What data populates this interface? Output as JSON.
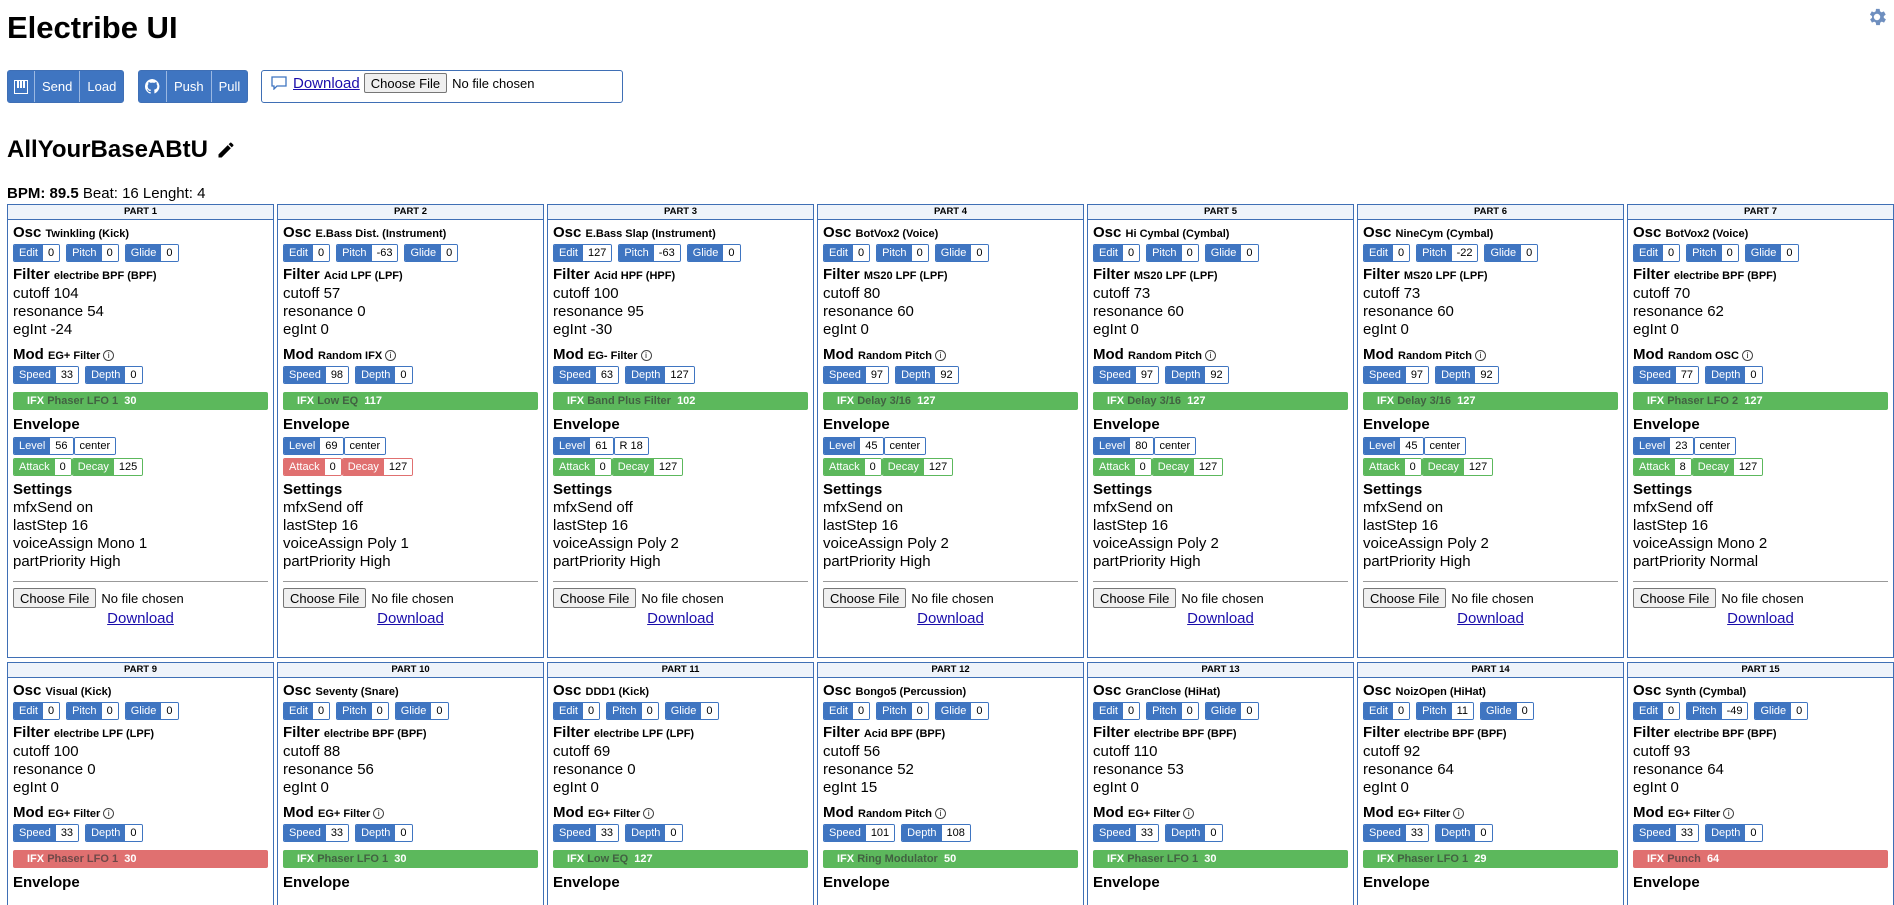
{
  "app_title": "Electribe UI",
  "toolbar": {
    "send_label": "Send",
    "load_label": "Load",
    "push_label": "Push",
    "pull_label": "Pull",
    "download_label": "Download",
    "choose_file_label": "Choose File",
    "no_file_label": "No file chosen"
  },
  "song": {
    "name": "AllYourBaseABtU",
    "bpm_label": "BPM:",
    "bpm": "89.5",
    "beat_text": "Beat: 16 Lenght: 4"
  },
  "labels": {
    "osc": "Osc",
    "filter": "Filter",
    "mod": "Mod",
    "envelope": "Envelope",
    "settings": "Settings",
    "edit": "Edit",
    "pitch": "Pitch",
    "glide": "Glide",
    "speed": "Speed",
    "depth": "Depth",
    "level": "Level",
    "attack": "Attack",
    "decay": "Decay",
    "ifx": "IFX",
    "choose_file": "Choose File",
    "no_file": "No file chosen",
    "download": "Download"
  },
  "colors": {
    "accent": "#3f75c1",
    "ifx_on": "#5cb85c",
    "ifx_off": "#e07070"
  },
  "parts": [
    {
      "header": "PART 1",
      "osc": "Twinkling (Kick)",
      "edit": "0",
      "pitch": "0",
      "glide": "0",
      "filter": "electribe BPF (BPF)",
      "cutoff": "cutoff 104",
      "resonance": "resonance 54",
      "egint": "egInt -24",
      "mod": "EG+ Filter",
      "speed": "33",
      "depth": "0",
      "ifx_name": "Phaser LFO 1",
      "ifx_value": "30",
      "ifx_on": true,
      "level": "56",
      "pan": "center",
      "attack": "0",
      "decay": "125",
      "env_on": true,
      "mfx": "mfxSend on",
      "laststep": "lastStep 16",
      "voice": "voiceAssign Mono 1",
      "priority": "partPriority High"
    },
    {
      "header": "PART 2",
      "osc": "E.Bass Dist. (Instrument)",
      "edit": "0",
      "pitch": "-63",
      "glide": "0",
      "filter": "Acid LPF (LPF)",
      "cutoff": "cutoff 57",
      "resonance": "resonance 0",
      "egint": "egInt 0",
      "mod": "Random IFX",
      "speed": "98",
      "depth": "0",
      "ifx_name": "Low EQ",
      "ifx_value": "117",
      "ifx_on": true,
      "level": "69",
      "pan": "center",
      "attack": "0",
      "decay": "127",
      "env_on": false,
      "mfx": "mfxSend off",
      "laststep": "lastStep 16",
      "voice": "voiceAssign Poly 1",
      "priority": "partPriority High"
    },
    {
      "header": "PART 3",
      "osc": "E.Bass Slap (Instrument)",
      "edit": "127",
      "pitch": "-63",
      "glide": "0",
      "filter": "Acid HPF (HPF)",
      "cutoff": "cutoff 100",
      "resonance": "resonance 95",
      "egint": "egInt -30",
      "mod": "EG- Filter",
      "speed": "63",
      "depth": "127",
      "ifx_name": "Band Plus Filter",
      "ifx_value": "102",
      "ifx_on": true,
      "level": "61",
      "pan": "R 18",
      "attack": "0",
      "decay": "127",
      "env_on": true,
      "mfx": "mfxSend off",
      "laststep": "lastStep 16",
      "voice": "voiceAssign Poly 2",
      "priority": "partPriority High"
    },
    {
      "header": "PART 4",
      "osc": "BotVox2 (Voice)",
      "edit": "0",
      "pitch": "0",
      "glide": "0",
      "filter": "MS20 LPF (LPF)",
      "cutoff": "cutoff 80",
      "resonance": "resonance 60",
      "egint": "egInt 0",
      "mod": "Random Pitch",
      "speed": "97",
      "depth": "92",
      "ifx_name": "Delay 3/16",
      "ifx_value": "127",
      "ifx_on": true,
      "level": "45",
      "pan": "center",
      "attack": "0",
      "decay": "127",
      "env_on": true,
      "mfx": "mfxSend on",
      "laststep": "lastStep 16",
      "voice": "voiceAssign Poly 2",
      "priority": "partPriority High"
    },
    {
      "header": "PART 5",
      "osc": "Hi Cymbal (Cymbal)",
      "edit": "0",
      "pitch": "0",
      "glide": "0",
      "filter": "MS20 LPF (LPF)",
      "cutoff": "cutoff 73",
      "resonance": "resonance 60",
      "egint": "egInt 0",
      "mod": "Random Pitch",
      "speed": "97",
      "depth": "92",
      "ifx_name": "Delay 3/16",
      "ifx_value": "127",
      "ifx_on": true,
      "level": "80",
      "pan": "center",
      "attack": "0",
      "decay": "127",
      "env_on": true,
      "mfx": "mfxSend on",
      "laststep": "lastStep 16",
      "voice": "voiceAssign Poly 2",
      "priority": "partPriority High"
    },
    {
      "header": "PART 6",
      "osc": "NineCym (Cymbal)",
      "edit": "0",
      "pitch": "-22",
      "glide": "0",
      "filter": "MS20 LPF (LPF)",
      "cutoff": "cutoff 73",
      "resonance": "resonance 60",
      "egint": "egInt 0",
      "mod": "Random Pitch",
      "speed": "97",
      "depth": "92",
      "ifx_name": "Delay 3/16",
      "ifx_value": "127",
      "ifx_on": true,
      "level": "45",
      "pan": "center",
      "attack": "0",
      "decay": "127",
      "env_on": true,
      "mfx": "mfxSend on",
      "laststep": "lastStep 16",
      "voice": "voiceAssign Poly 2",
      "priority": "partPriority High"
    },
    {
      "header": "PART 7",
      "osc": "BotVox2 (Voice)",
      "edit": "0",
      "pitch": "0",
      "glide": "0",
      "filter": "electribe BPF (BPF)",
      "cutoff": "cutoff 70",
      "resonance": "resonance 62",
      "egint": "egInt 0",
      "mod": "Random OSC",
      "speed": "77",
      "depth": "0",
      "ifx_name": "Phaser LFO 2",
      "ifx_value": "127",
      "ifx_on": true,
      "level": "23",
      "pan": "center",
      "attack": "8",
      "decay": "127",
      "env_on": true,
      "mfx": "mfxSend off",
      "laststep": "lastStep 16",
      "voice": "voiceAssign Mono 2",
      "priority": "partPriority Normal"
    },
    {
      "header": "PART 9",
      "osc": "Visual (Kick)",
      "edit": "0",
      "pitch": "0",
      "glide": "0",
      "filter": "electribe LPF (LPF)",
      "cutoff": "cutoff 100",
      "resonance": "resonance 0",
      "egint": "egInt 0",
      "mod": "EG+ Filter",
      "speed": "33",
      "depth": "0",
      "ifx_name": "Phaser LFO 1",
      "ifx_value": "30",
      "ifx_on": false
    },
    {
      "header": "PART 10",
      "osc": "Seventy (Snare)",
      "edit": "0",
      "pitch": "0",
      "glide": "0",
      "filter": "electribe BPF (BPF)",
      "cutoff": "cutoff 88",
      "resonance": "resonance 56",
      "egint": "egInt 0",
      "mod": "EG+ Filter",
      "speed": "33",
      "depth": "0",
      "ifx_name": "Phaser LFO 1",
      "ifx_value": "30",
      "ifx_on": true
    },
    {
      "header": "PART 11",
      "osc": "DDD1 (Kick)",
      "edit": "0",
      "pitch": "0",
      "glide": "0",
      "filter": "electribe LPF (LPF)",
      "cutoff": "cutoff 69",
      "resonance": "resonance 0",
      "egint": "egInt 0",
      "mod": "EG+ Filter",
      "speed": "33",
      "depth": "0",
      "ifx_name": "Low EQ",
      "ifx_value": "127",
      "ifx_on": true
    },
    {
      "header": "PART 12",
      "osc": "Bongo5 (Percussion)",
      "edit": "0",
      "pitch": "0",
      "glide": "0",
      "filter": "Acid BPF (BPF)",
      "cutoff": "cutoff 56",
      "resonance": "resonance 52",
      "egint": "egInt 15",
      "mod": "Random Pitch",
      "speed": "101",
      "depth": "108",
      "ifx_name": "Ring Modulator",
      "ifx_value": "50",
      "ifx_on": true
    },
    {
      "header": "PART 13",
      "osc": "GranClose (HiHat)",
      "edit": "0",
      "pitch": "0",
      "glide": "0",
      "filter": "electribe BPF (BPF)",
      "cutoff": "cutoff 110",
      "resonance": "resonance 53",
      "egint": "egInt 0",
      "mod": "EG+ Filter",
      "speed": "33",
      "depth": "0",
      "ifx_name": "Phaser LFO 1",
      "ifx_value": "30",
      "ifx_on": true
    },
    {
      "header": "PART 14",
      "osc": "NoizOpen (HiHat)",
      "edit": "0",
      "pitch": "11",
      "glide": "0",
      "filter": "electribe BPF (BPF)",
      "cutoff": "cutoff 92",
      "resonance": "resonance 64",
      "egint": "egInt 0",
      "mod": "EG+ Filter",
      "speed": "33",
      "depth": "0",
      "ifx_name": "Phaser LFO 1",
      "ifx_value": "29",
      "ifx_on": true
    },
    {
      "header": "PART 15",
      "osc": "Synth (Cymbal)",
      "edit": "0",
      "pitch": "-49",
      "glide": "0",
      "filter": "electribe BPF (BPF)",
      "cutoff": "cutoff 93",
      "resonance": "resonance 64",
      "egint": "egInt 0",
      "mod": "EG+ Filter",
      "speed": "33",
      "depth": "0",
      "ifx_name": "Punch",
      "ifx_value": "64",
      "ifx_on": false
    }
  ]
}
